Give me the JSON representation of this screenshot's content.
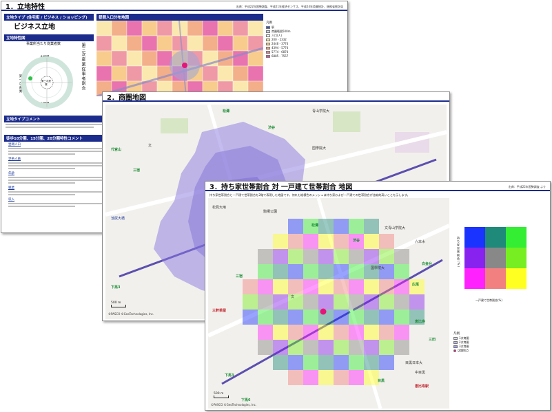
{
  "sheet1": {
    "title": "1．立地特性",
    "source": "出典：平成22年国勢調査、平成21年経済センサス、平成24年商業統計、総務省統計局",
    "location_type_bar": "立地タイプ (住宅街 / ビジネス / ショッピング)",
    "location_type_value": "ビジネス立地",
    "features_bar": "立地特性図",
    "radar_top": "事業所当たり従業者数",
    "radar_top2": "大規模",
    "radar_left": "第一次産業",
    "radar_bottom": "小規模",
    "radar_center": "第三次産業",
    "radar_right_vertical": "第三次産業従事者割合",
    "pop_map_bar": "昼間人口分布地図",
    "legend_title": "凡例",
    "legend_items": [
      {
        "label": "駅",
        "color": "#3355cc"
      },
      {
        "label": "商圏範囲500m",
        "color": "#cfd6ee"
      },
      {
        "label": "人口(人)",
        "color": "#ffffff"
      },
      {
        "label": "200 - 2332",
        "color": "#ffe69a"
      },
      {
        "label": "2446 - 3774",
        "color": "#f9c06e"
      },
      {
        "label": "4394 - 5774",
        "color": "#f49a6a"
      },
      {
        "label": "5774 - 6874",
        "color": "#ee7d8f"
      },
      {
        "label": "6885 - 7557",
        "color": "#e54a9a"
      }
    ],
    "comment_bar": "立地タイプコメント",
    "walk_bar": "徒歩10分圏、15分圏、20分圏特性コメント",
    "sub1": "昼間人口",
    "sub2": "世帯人員",
    "sub3": "年齢",
    "sub4": "職業",
    "sub5": "収入"
  },
  "sheet2": {
    "title": "2．商圏地図",
    "labels": {
      "shibuya": "渋谷",
      "shoto": "松濤",
      "daikanyama": "代官山",
      "sanshuku": "三宿",
      "ikejiri": "池尻大橋",
      "shimouma": "下馬3",
      "bunka": "文",
      "kokugakuin": "国學院大",
      "aoyama": "青山学院大",
      "hiroo": "広尾",
      "sangenjaya": "三軒茶屋駅"
    },
    "scale": "500 m",
    "copyright": "©PASCO ©GeoTechnologies, Inc."
  },
  "sheet3": {
    "title": "3．持ち家世帯割合 対 一戸建て世帯割合 地図",
    "source": "出典：平成22年国勢調査 より",
    "description": "持ち家世帯割合と一戸建て世帯割合を2軸で表現した地図です。何れも縦横色のメッシュは持ち家および一戸建ての世帯割合が比較的高いことを示します。",
    "labels": {
      "shibuya": "渋谷",
      "shoto": "松濤",
      "komaba": "駒場公園",
      "matsumi": "松見大用",
      "sanshuku": "三宿",
      "sangen": "三軒茶屋",
      "shimouma": "下馬3",
      "shimouma6": "下馬6",
      "hiroo": "広尾",
      "ebisu": "恵比寿",
      "mita": "三田",
      "aoyama": "文青山学院大",
      "roppongi": "六本木",
      "meguro": "目黒",
      "nakameguro": "目黒日本大",
      "shiroganedai": "白金台",
      "kokugakuin": "国學院大",
      "kanzan": "文",
      "ebisueki": "恵比寿駅",
      "tokyo": "中目黒"
    },
    "matrix_xlabel": "一戸建て世帯割合(%)",
    "matrix_ylabel": "持ち家世帯割合(%)",
    "matrix_colors": [
      [
        "#1a33ff",
        "#1f8a7a",
        "#33ee33"
      ],
      [
        "#8822ee",
        "#888888",
        "#77ee22"
      ],
      [
        "#ff22ff",
        "#f28080",
        "#ffff22"
      ]
    ],
    "legend_title": "凡例",
    "legend_items": [
      {
        "label": "1次商圏",
        "color": "#d6d6ee"
      },
      {
        "label": "2次商圏",
        "color": "#b9b9ee"
      },
      {
        "label": "3次商圏",
        "color": "#9f9ff0"
      },
      {
        "label": "店舗地点",
        "color": "#e6157a"
      }
    ],
    "scale": "500 m",
    "copyright": "©PASCO ©GeoTechnologies, Inc."
  }
}
